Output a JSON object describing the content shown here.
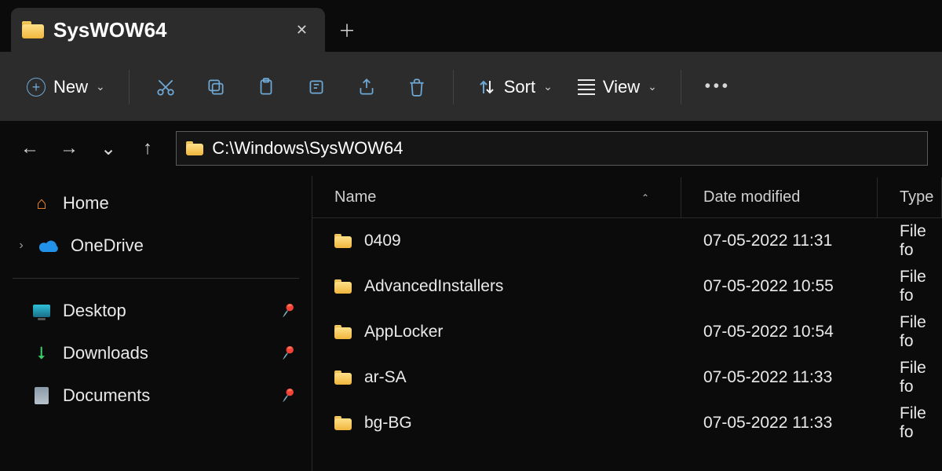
{
  "tab": {
    "title": "SysWOW64"
  },
  "toolbar": {
    "new_label": "New",
    "sort_label": "Sort",
    "view_label": "View"
  },
  "address": {
    "path": "C:\\Windows\\SysWOW64"
  },
  "sidebar": {
    "home": "Home",
    "onedrive": "OneDrive",
    "quick": [
      {
        "label": "Desktop"
      },
      {
        "label": "Downloads"
      },
      {
        "label": "Documents"
      }
    ]
  },
  "columns": {
    "name": "Name",
    "modified": "Date modified",
    "type": "Type"
  },
  "rows": [
    {
      "name": "0409",
      "modified": "07-05-2022 11:31",
      "type": "File fo"
    },
    {
      "name": "AdvancedInstallers",
      "modified": "07-05-2022 10:55",
      "type": "File fo"
    },
    {
      "name": "AppLocker",
      "modified": "07-05-2022 10:54",
      "type": "File fo"
    },
    {
      "name": "ar-SA",
      "modified": "07-05-2022 11:33",
      "type": "File fo"
    },
    {
      "name": "bg-BG",
      "modified": "07-05-2022 11:33",
      "type": "File fo"
    }
  ]
}
